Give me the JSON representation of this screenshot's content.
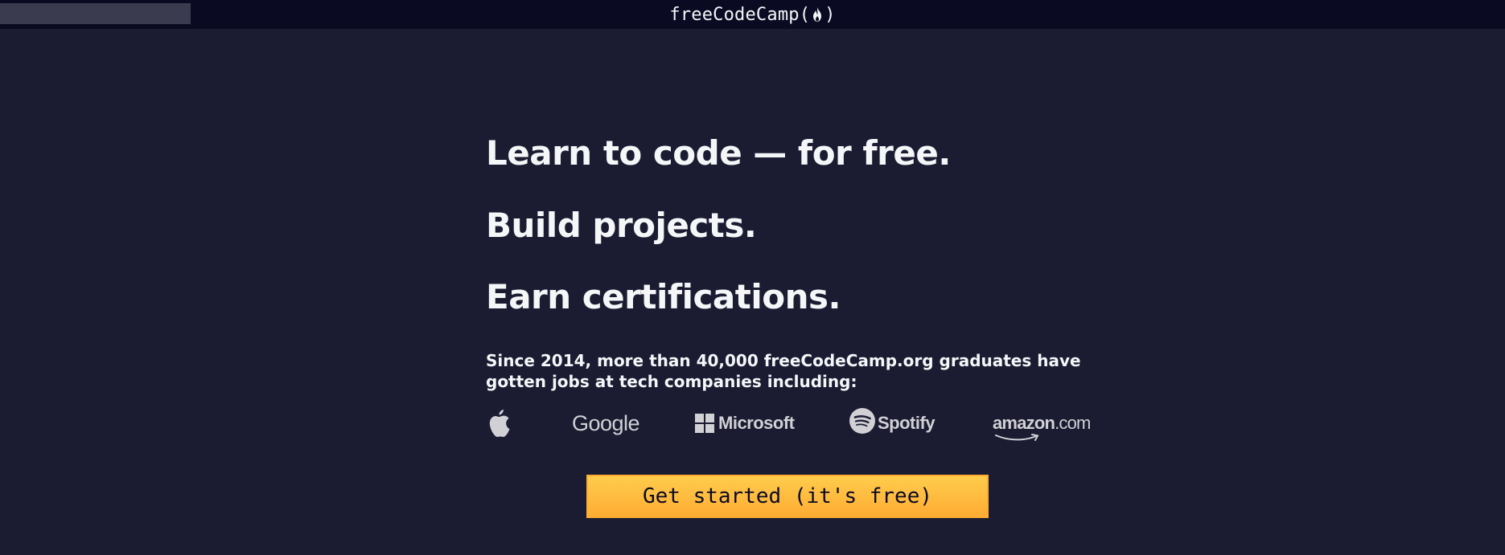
{
  "navbar": {
    "search_placeholder": "",
    "logo_text_left": "freeCodeCamp(",
    "logo_text_right": ")",
    "logo_icon": "flame-icon"
  },
  "hero": {
    "line1": "Learn to code — for free.",
    "line2": "Build projects.",
    "line3": "Earn certifications.",
    "subtext": "Since 2014, more than 40,000 freeCodeCamp.org graduates have gotten jobs at tech companies including:"
  },
  "companies": {
    "apple": "apple-logo-icon",
    "google": "Google",
    "microsoft": "Microsoft",
    "spotify": "Spotify",
    "amazon_main": "amazon",
    "amazon_suffix": ".com"
  },
  "cta": {
    "label": "Get started (it's free)"
  },
  "colors": {
    "background": "#1b1b32",
    "navbar": "#0a0a23",
    "text": "#f5f6f7",
    "logo_gray": "#d0d0d5",
    "cta_yellow": "#feac32"
  }
}
